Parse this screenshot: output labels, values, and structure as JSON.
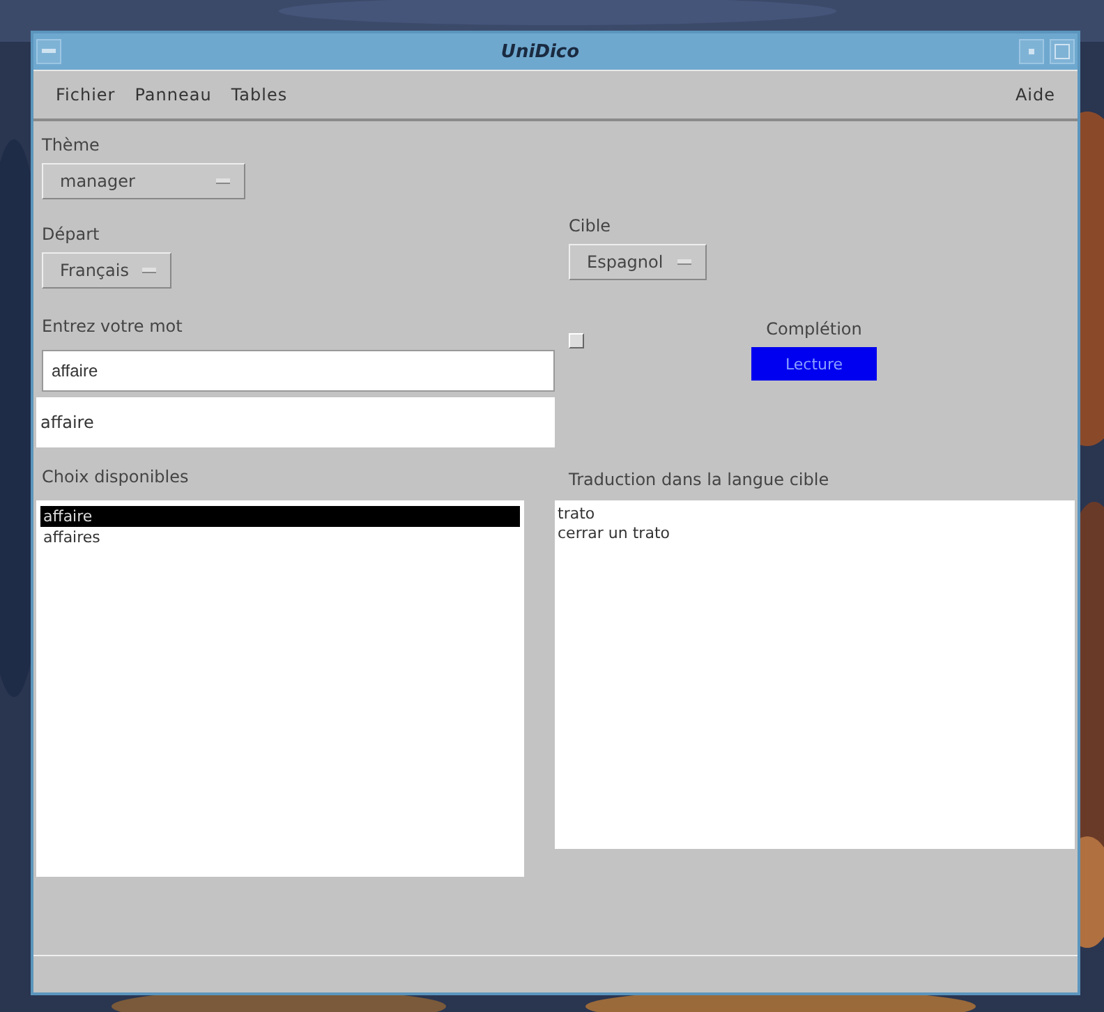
{
  "window": {
    "title": "UniDico"
  },
  "menu": {
    "items": [
      "Fichier",
      "Panneau",
      "Tables"
    ],
    "help": "Aide"
  },
  "theme": {
    "label": "Thème",
    "value": "manager"
  },
  "source": {
    "label": "Départ",
    "value": "Français"
  },
  "target": {
    "label": "Cible",
    "value": "Espagnol"
  },
  "entry": {
    "label": "Entrez votre mot",
    "value": "affaire"
  },
  "completion_field": {
    "value": "affaire"
  },
  "completion": {
    "label": "Complétion",
    "checked": false,
    "button": "Lecture"
  },
  "choices": {
    "label": "Choix disponibles",
    "items": [
      {
        "text": "affaire",
        "selected": true
      },
      {
        "text": "affaires",
        "selected": false
      }
    ]
  },
  "translation": {
    "label": "Traduction dans la langue cible",
    "lines": [
      "trato",
      "cerrar un trato"
    ]
  }
}
